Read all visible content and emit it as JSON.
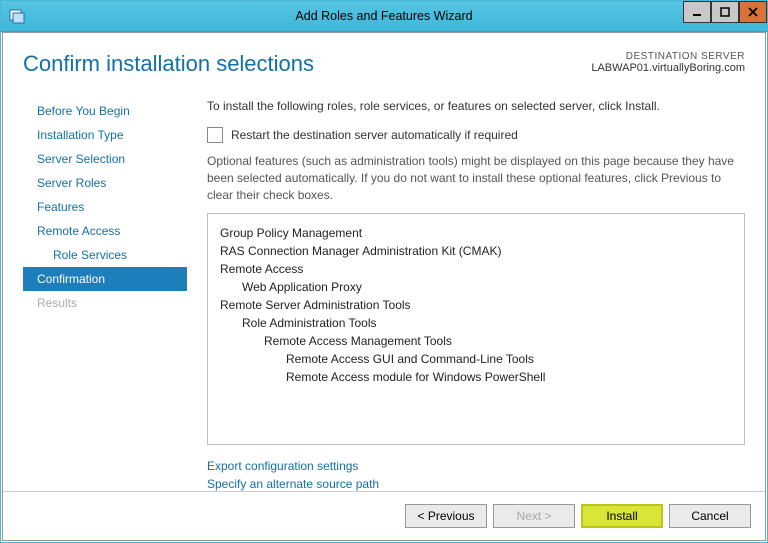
{
  "window": {
    "title": "Add Roles and Features Wizard"
  },
  "header": {
    "heading": "Confirm installation selections",
    "destination_label": "DESTINATION SERVER",
    "destination_server": "LABWAP01.virtuallyBoring.com"
  },
  "nav": {
    "items": [
      {
        "label": "Before You Begin",
        "selected": false
      },
      {
        "label": "Installation Type",
        "selected": false
      },
      {
        "label": "Server Selection",
        "selected": false
      },
      {
        "label": "Server Roles",
        "selected": false
      },
      {
        "label": "Features",
        "selected": false
      },
      {
        "label": "Remote Access",
        "selected": false
      },
      {
        "label": "Role Services",
        "selected": false,
        "indent": true
      },
      {
        "label": "Confirmation",
        "selected": true
      },
      {
        "label": "Results",
        "disabled": true
      }
    ]
  },
  "main": {
    "intro": "To install the following roles, role services, or features on selected server, click Install.",
    "restart_checkbox_label": "Restart the destination server automatically if required",
    "optional_note": "Optional features (such as administration tools) might be displayed on this page because they have been selected automatically. If you do not want to install these optional features, click Previous to clear their check boxes.",
    "features": [
      {
        "text": "Group Policy Management",
        "indent": 0
      },
      {
        "text": "RAS Connection Manager Administration Kit (CMAK)",
        "indent": 0
      },
      {
        "text": "Remote Access",
        "indent": 0
      },
      {
        "text": "Web Application Proxy",
        "indent": 1
      },
      {
        "text": "Remote Server Administration Tools",
        "indent": 0
      },
      {
        "text": "Role Administration Tools",
        "indent": 1
      },
      {
        "text": "Remote Access Management Tools",
        "indent": 2
      },
      {
        "text": "Remote Access GUI and Command-Line Tools",
        "indent": 3
      },
      {
        "text": "Remote Access module for Windows PowerShell",
        "indent": 3
      }
    ],
    "links": {
      "export": "Export configuration settings",
      "alt_path": "Specify an alternate source path"
    }
  },
  "footer": {
    "previous": "< Previous",
    "next": "Next >",
    "install": "Install",
    "cancel": "Cancel"
  }
}
